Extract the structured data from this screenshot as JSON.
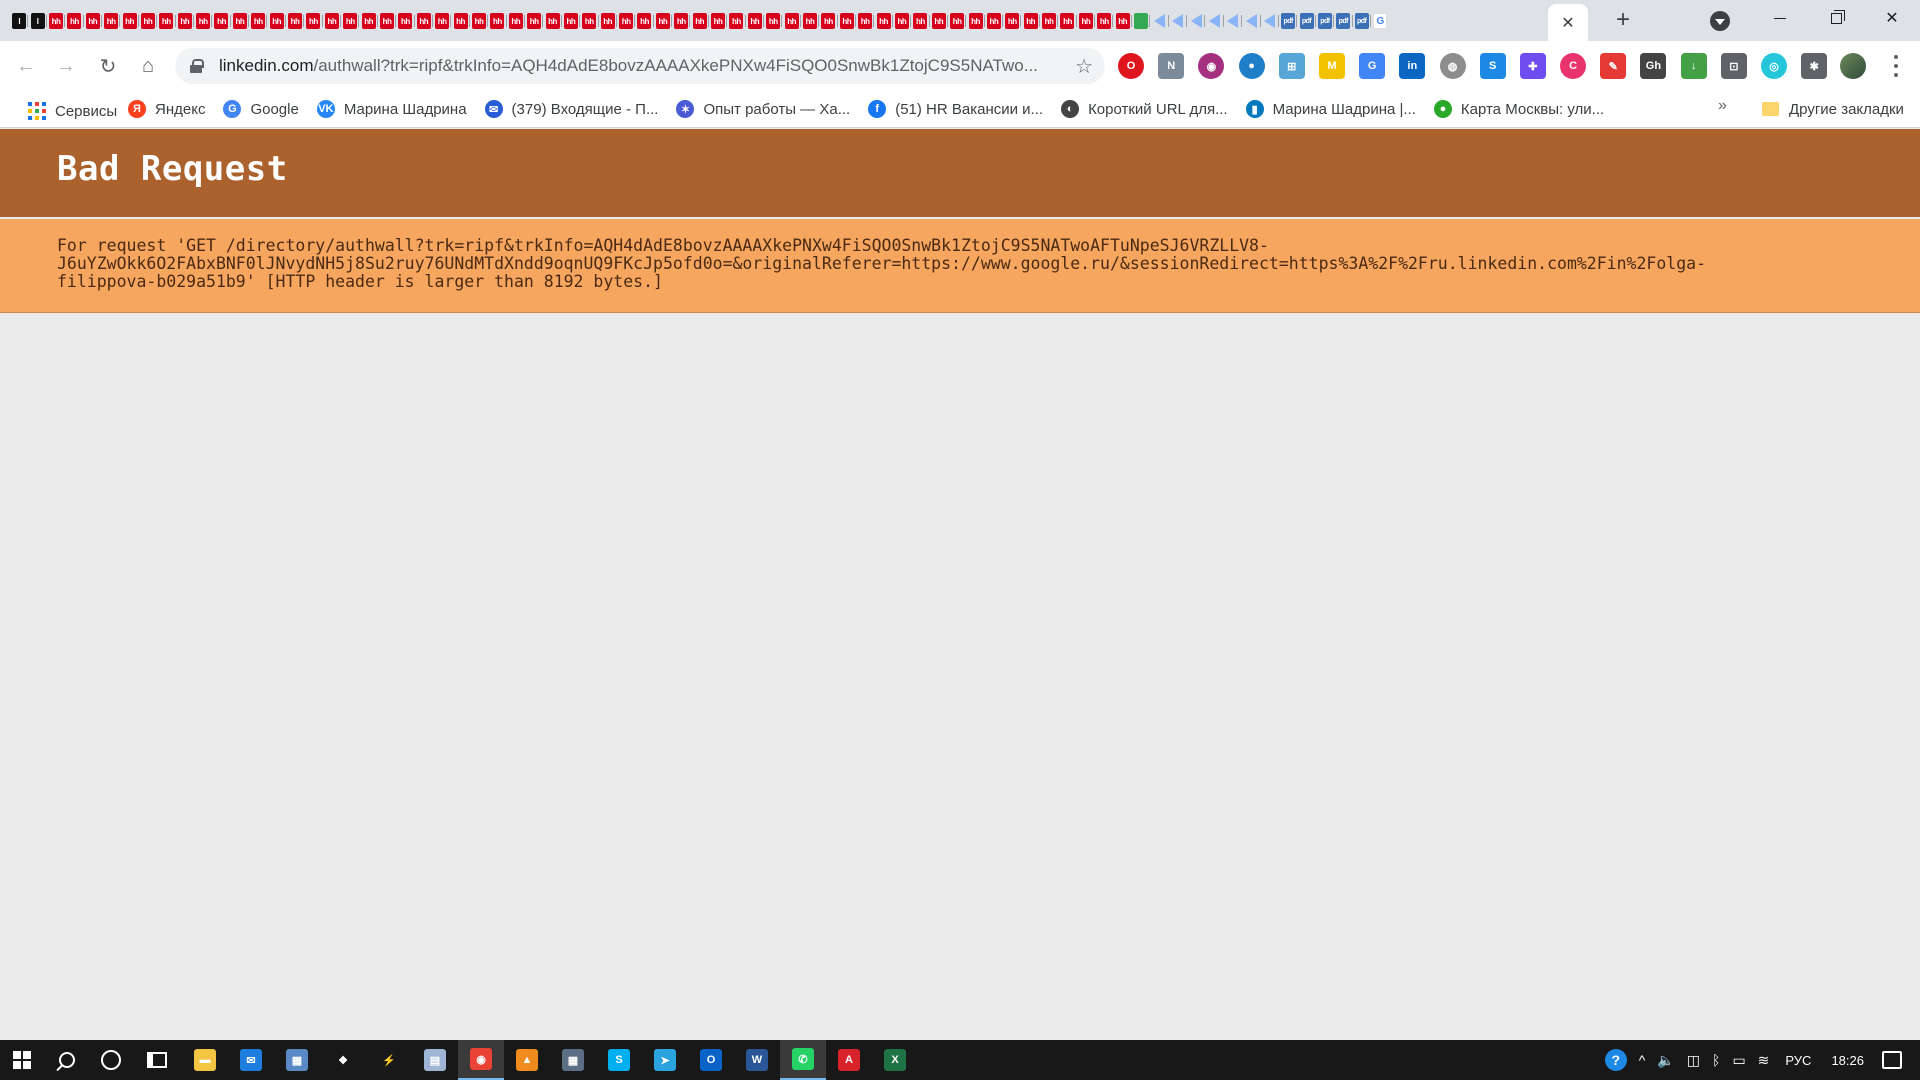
{
  "window": {
    "tab_close_glyph": "✕",
    "new_tab_glyph": "+"
  },
  "tabs": [
    {
      "kind": "doc",
      "label": "I"
    },
    {
      "kind": "doc",
      "label": "I"
    },
    {
      "kind": "hh",
      "label": "hh"
    },
    {
      "kind": "hh",
      "label": "hh"
    },
    {
      "kind": "hh",
      "label": "hh"
    },
    {
      "kind": "hh",
      "label": "hh"
    },
    {
      "kind": "hh",
      "label": "hh"
    },
    {
      "kind": "hh",
      "label": "hh"
    },
    {
      "kind": "hh",
      "label": "hh"
    },
    {
      "kind": "hh",
      "label": "hh"
    },
    {
      "kind": "hh",
      "label": "hh"
    },
    {
      "kind": "hh",
      "label": "hh"
    },
    {
      "kind": "hh",
      "label": "hh"
    },
    {
      "kind": "hh",
      "label": "hh"
    },
    {
      "kind": "hh",
      "label": "hh"
    },
    {
      "kind": "hh",
      "label": "hh"
    },
    {
      "kind": "hh",
      "label": "hh"
    },
    {
      "kind": "hh",
      "label": "hh"
    },
    {
      "kind": "hh",
      "label": "hh"
    },
    {
      "kind": "hh",
      "label": "hh"
    },
    {
      "kind": "hh",
      "label": "hh"
    },
    {
      "kind": "hh",
      "label": "hh"
    },
    {
      "kind": "hh",
      "label": "hh"
    },
    {
      "kind": "hh",
      "label": "hh"
    },
    {
      "kind": "hh",
      "label": "hh"
    },
    {
      "kind": "hh",
      "label": "hh"
    },
    {
      "kind": "hh",
      "label": "hh"
    },
    {
      "kind": "hh",
      "label": "hh"
    },
    {
      "kind": "hh",
      "label": "hh"
    },
    {
      "kind": "hh",
      "label": "hh"
    },
    {
      "kind": "hh",
      "label": "hh"
    },
    {
      "kind": "hh",
      "label": "hh"
    },
    {
      "kind": "hh",
      "label": "hh"
    },
    {
      "kind": "hh",
      "label": "hh"
    },
    {
      "kind": "hh",
      "label": "hh"
    },
    {
      "kind": "hh",
      "label": "hh"
    },
    {
      "kind": "hh",
      "label": "hh"
    },
    {
      "kind": "hh",
      "label": "hh"
    },
    {
      "kind": "hh",
      "label": "hh"
    },
    {
      "kind": "hh",
      "label": "hh"
    },
    {
      "kind": "hh",
      "label": "hh"
    },
    {
      "kind": "hh",
      "label": "hh"
    },
    {
      "kind": "hh",
      "label": "hh"
    },
    {
      "kind": "hh",
      "label": "hh"
    },
    {
      "kind": "hh",
      "label": "hh"
    },
    {
      "kind": "hh",
      "label": "hh"
    },
    {
      "kind": "hh",
      "label": "hh"
    },
    {
      "kind": "hh",
      "label": "hh"
    },
    {
      "kind": "hh",
      "label": "hh"
    },
    {
      "kind": "hh",
      "label": "hh"
    },
    {
      "kind": "hh",
      "label": "hh"
    },
    {
      "kind": "hh",
      "label": "hh"
    },
    {
      "kind": "hh",
      "label": "hh"
    },
    {
      "kind": "hh",
      "label": "hh"
    },
    {
      "kind": "hh",
      "label": "hh"
    },
    {
      "kind": "hh",
      "label": "hh"
    },
    {
      "kind": "hh",
      "label": "hh"
    },
    {
      "kind": "hh",
      "label": "hh"
    },
    {
      "kind": "hh",
      "label": "hh"
    },
    {
      "kind": "hh",
      "label": "hh"
    },
    {
      "kind": "hh",
      "label": "hh"
    },
    {
      "kind": "gdoc",
      "label": ""
    },
    {
      "kind": "tri",
      "label": ""
    },
    {
      "kind": "tri",
      "label": ""
    },
    {
      "kind": "tri",
      "label": ""
    },
    {
      "kind": "tri",
      "label": ""
    },
    {
      "kind": "tri",
      "label": ""
    },
    {
      "kind": "tri",
      "label": ""
    },
    {
      "kind": "tri",
      "label": ""
    },
    {
      "kind": "pdf",
      "label": "pdf"
    },
    {
      "kind": "pdf",
      "label": "pdf"
    },
    {
      "kind": "pdf",
      "label": "pdf"
    },
    {
      "kind": "pdf",
      "label": "pdf"
    },
    {
      "kind": "pdf",
      "label": "pdf"
    },
    {
      "kind": "google",
      "label": "G"
    }
  ],
  "toolbar": {
    "url_host": "linkedin.com",
    "url_path": "/authwall?trk=ripf&trkInfo=AQH4dAdE8bovzAAAAXkePNXw4FiSQO0SnwBk1ZtojC9S5NATwo...",
    "star_glyph": "☆",
    "back_glyph": "←",
    "forward_glyph": "→",
    "reload_glyph": "↻",
    "home_glyph": "⌂"
  },
  "extensions": [
    {
      "name": "opera-extension",
      "color": "#e0161e",
      "label": "O",
      "round": true
    },
    {
      "name": "news-extension",
      "color": "#7c8a99",
      "label": "N",
      "round": false
    },
    {
      "name": "circle-extension",
      "color": "#a4307f",
      "label": "◉",
      "round": true
    },
    {
      "name": "blue-dot-extension",
      "color": "#1e7ec8",
      "label": "●",
      "round": true
    },
    {
      "name": "map-extension",
      "color": "#58a6d6",
      "label": "⊞",
      "round": false
    },
    {
      "name": "m-extension",
      "color": "#f2c200",
      "label": "M",
      "round": false
    },
    {
      "name": "translate-extension",
      "color": "#4285f4",
      "label": "G",
      "round": false
    },
    {
      "name": "linkedin-extension",
      "color": "#0a66c2",
      "label": "in",
      "round": false
    },
    {
      "name": "globe-extension",
      "color": "#8d8d8d",
      "label": "◍",
      "round": true
    },
    {
      "name": "s-extension",
      "color": "#1e88e5",
      "label": "S",
      "round": false
    },
    {
      "name": "plus-extension",
      "color": "#6e4df0",
      "label": "✚",
      "round": false
    },
    {
      "name": "c-extension",
      "color": "#e8336c",
      "label": "C",
      "round": true
    },
    {
      "name": "pen-extension",
      "color": "#e53935",
      "label": "✎",
      "round": false
    },
    {
      "name": "github-email-extension",
      "color": "#444444",
      "label": "Gh",
      "round": false
    },
    {
      "name": "download-extension",
      "color": "#43a047",
      "label": "↓",
      "round": false
    },
    {
      "name": "puzzle-dark-extension",
      "color": "#5f6368",
      "label": "⊡",
      "round": false
    },
    {
      "name": "fingerprint-extension",
      "color": "#26c6da",
      "label": "◎",
      "round": true
    },
    {
      "name": "extensions-menu",
      "color": "#5f6368",
      "label": "✱",
      "round": false
    }
  ],
  "bookmarks": {
    "apps_label": "Сервисы",
    "items": [
      {
        "label": "Яндекс",
        "color": "#fc3f1d",
        "icon": "Я"
      },
      {
        "label": "Google",
        "color": "#4285f4",
        "icon": "G"
      },
      {
        "label": "Марина Шадрина",
        "color": "#2787f5",
        "icon": "VK"
      },
      {
        "label": "(379) Входящие - П...",
        "color": "#2a5bd7",
        "icon": "✉"
      },
      {
        "label": "Опыт работы — Ха...",
        "color": "#4b5bd6",
        "icon": "✶"
      },
      {
        "label": "(51) HR Вакансии и...",
        "color": "#1877f2",
        "icon": "f"
      },
      {
        "label": "Короткий URL для...",
        "color": "#444444",
        "icon": "◐"
      },
      {
        "label": "Марина Шадрина |...",
        "color": "#0079bf",
        "icon": "▮"
      },
      {
        "label": "Карта Москвы: ули...",
        "color": "#29a829",
        "icon": "●"
      }
    ],
    "more_glyph": "»",
    "other_label": "Другие закладки"
  },
  "page": {
    "title": "Bad Request",
    "message": "For request 'GET /directory/authwall?trk=ripf&trkInfo=AQH4dAdE8bovzAAAAXkePNXw4FiSQO0SnwBk1ZtojC9S5NATwoAFTuNpeSJ6VRZLLV8-\nJ6uYZwOkk6O2FAbxBNF0lJNvydNH5j8Su2ruy76UNdMTdXndd9oqnUQ9FKcJp5ofd0o=&originalReferer=https://www.google.ru/&sessionRedirect=https%3A%2F%2Fru.linkedin.com%2Fin%2Folga-\nfilippova-b029a51b9' [HTTP header is larger than 8192 bytes.]",
    "header_color": "#ac622d",
    "message_color": "#f7a660"
  },
  "taskbar": {
    "apps": [
      {
        "name": "file-explorer-icon",
        "color": "#f4c542",
        "label": "▬",
        "active": false
      },
      {
        "name": "mail-icon",
        "color": "#1f7de0",
        "label": "✉",
        "active": false
      },
      {
        "name": "photo-viewer-icon",
        "color": "#5a8ac6",
        "label": "▦",
        "active": false
      },
      {
        "name": "dropbox-icon",
        "color": "#181818",
        "label": "❖",
        "active": false
      },
      {
        "name": "bolt-app-icon",
        "color": "#181818",
        "label": "⚡",
        "active": false
      },
      {
        "name": "notepad-icon",
        "color": "#9fb5d5",
        "label": "▤",
        "active": false
      },
      {
        "name": "chrome-icon",
        "color": "#ea4335",
        "label": "◉",
        "active": true
      },
      {
        "name": "vlc-icon",
        "color": "#f08b1d",
        "label": "▲",
        "active": false
      },
      {
        "name": "calculator-icon",
        "color": "#5c6f86",
        "label": "▦",
        "active": false
      },
      {
        "name": "skype-icon",
        "color": "#00aff0",
        "label": "S",
        "active": false
      },
      {
        "name": "telegram-icon",
        "color": "#2aa3de",
        "label": "➤",
        "active": false
      },
      {
        "name": "outlook-icon",
        "color": "#0a64c8",
        "label": "O",
        "active": false
      },
      {
        "name": "word-icon",
        "color": "#2b5797",
        "label": "W",
        "active": false
      },
      {
        "name": "whatsapp-icon",
        "color": "#25d366",
        "label": "✆",
        "active": true
      },
      {
        "name": "acrobat-icon",
        "color": "#d8232a",
        "label": "A",
        "active": false
      },
      {
        "name": "excel-icon",
        "color": "#1f7244",
        "label": "X",
        "active": false
      }
    ],
    "tray": {
      "help_glyph": "?",
      "chevron_glyph": "^",
      "volume_glyph": "🔈",
      "network_glyph": "◫",
      "bluetooth_glyph": "ᛒ",
      "battery_glyph": "▭",
      "wifi_glyph": "≋",
      "language": "РУС",
      "time": "18:26"
    }
  }
}
